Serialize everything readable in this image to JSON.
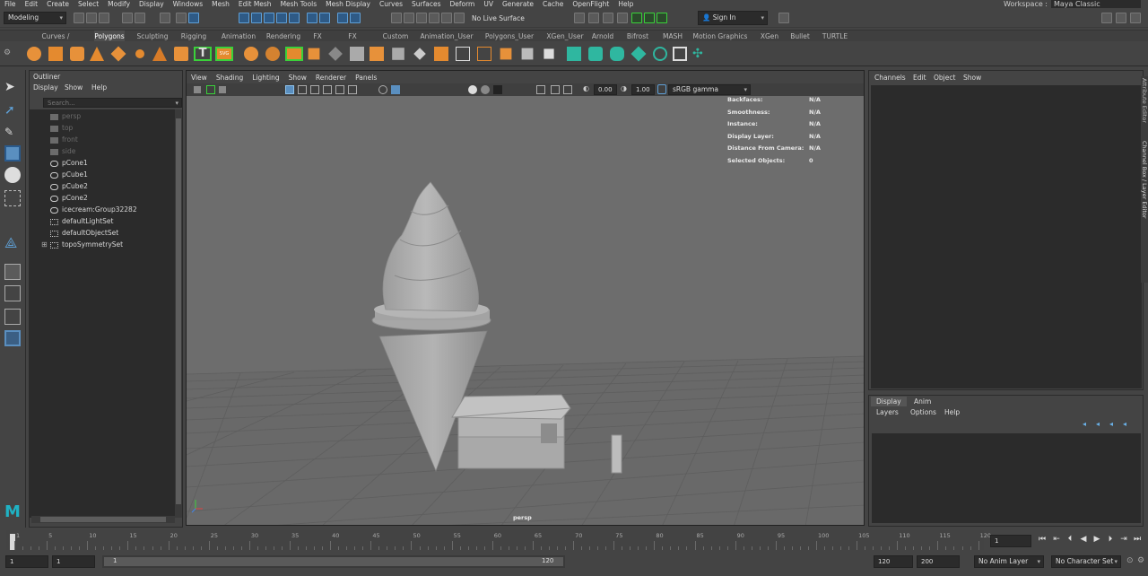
{
  "menubar": {
    "items": [
      "File",
      "Edit",
      "Create",
      "Select",
      "Modify",
      "Display",
      "Windows",
      "Mesh",
      "Edit Mesh",
      "Mesh Tools",
      "Mesh Display",
      "Curves",
      "Surfaces",
      "Deform",
      "UV",
      "Generate",
      "Cache",
      "OpenFlight",
      "Help"
    ]
  },
  "workspace": {
    "label": "Workspace :",
    "value": "Maya Classic"
  },
  "status": {
    "mode": "Modeling",
    "live_surface": "No Live Surface",
    "sign_in": "Sign In"
  },
  "shelf_tabs": [
    "Curves / Surfaces",
    "Polygons",
    "Sculpting",
    "Rigging",
    "Animation",
    "Rendering",
    "FX",
    "FX Caching",
    "Custom",
    "Animation_User",
    "Polygons_User",
    "XGen_User",
    "Arnold",
    "Bifrost",
    "MASH",
    "Motion Graphics",
    "XGen",
    "Bullet",
    "TURTLE"
  ],
  "shelf_active": "Polygons",
  "outliner": {
    "title": "Outliner",
    "menu": [
      "Display",
      "Show",
      "Help"
    ],
    "search_placeholder": "Search...",
    "items": [
      {
        "label": "persp",
        "icon": "camera-icon",
        "dim": true
      },
      {
        "label": "top",
        "icon": "camera-icon",
        "dim": true
      },
      {
        "label": "front",
        "icon": "camera-icon",
        "dim": true
      },
      {
        "label": "side",
        "icon": "camera-icon",
        "dim": true
      },
      {
        "label": "pCone1",
        "icon": "transform-icon",
        "dim": false
      },
      {
        "label": "pCube1",
        "icon": "transform-icon",
        "dim": false
      },
      {
        "label": "pCube2",
        "icon": "transform-icon",
        "dim": false
      },
      {
        "label": "pCone2",
        "icon": "transform-icon",
        "dim": false
      },
      {
        "label": "icecream:Group32282",
        "icon": "transform-icon",
        "dim": false
      },
      {
        "label": "defaultLightSet",
        "icon": "set-icon",
        "dim": false
      },
      {
        "label": "defaultObjectSet",
        "icon": "set-icon",
        "dim": false
      },
      {
        "label": "topoSymmetrySet",
        "icon": "set-icon",
        "dim": false
      }
    ]
  },
  "viewport": {
    "menu": [
      "View",
      "Shading",
      "Lighting",
      "Show",
      "Renderer",
      "Panels"
    ],
    "exposure": "0.00",
    "gamma": "1.00",
    "color_space": "sRGB gamma",
    "camera_label": "persp",
    "hud": [
      {
        "k": "Backfaces:",
        "v": "N/A"
      },
      {
        "k": "Smoothness:",
        "v": "N/A"
      },
      {
        "k": "Instance:",
        "v": "N/A"
      },
      {
        "k": "Display Layer:",
        "v": "N/A"
      },
      {
        "k": "Distance From Camera:",
        "v": "N/A"
      },
      {
        "k": "Selected Objects:",
        "v": "0"
      }
    ]
  },
  "channel_box": {
    "menu": [
      "Channels",
      "Edit",
      "Object",
      "Show"
    ]
  },
  "layer_editor": {
    "tabs": [
      "Display",
      "Anim"
    ],
    "menu": [
      "Layers",
      "Options",
      "Help"
    ]
  },
  "side_tabs": [
    "Attribute Editor",
    "Channel Box / Layer Editor"
  ],
  "time_slider": {
    "ticks": [
      "1",
      "5",
      "10",
      "15",
      "20",
      "25",
      "30",
      "35",
      "40",
      "45",
      "50",
      "55",
      "60",
      "65",
      "70",
      "75",
      "80",
      "85",
      "90",
      "95",
      "100",
      "105",
      "110",
      "115",
      "120"
    ],
    "current_frame": "1"
  },
  "range_slider": {
    "start": "1",
    "playback_start": "1",
    "range_start": "1",
    "range_end": "120",
    "playback_end": "120",
    "end": "200",
    "anim_layer": "No Anim Layer",
    "character_set": "No Character Set"
  }
}
